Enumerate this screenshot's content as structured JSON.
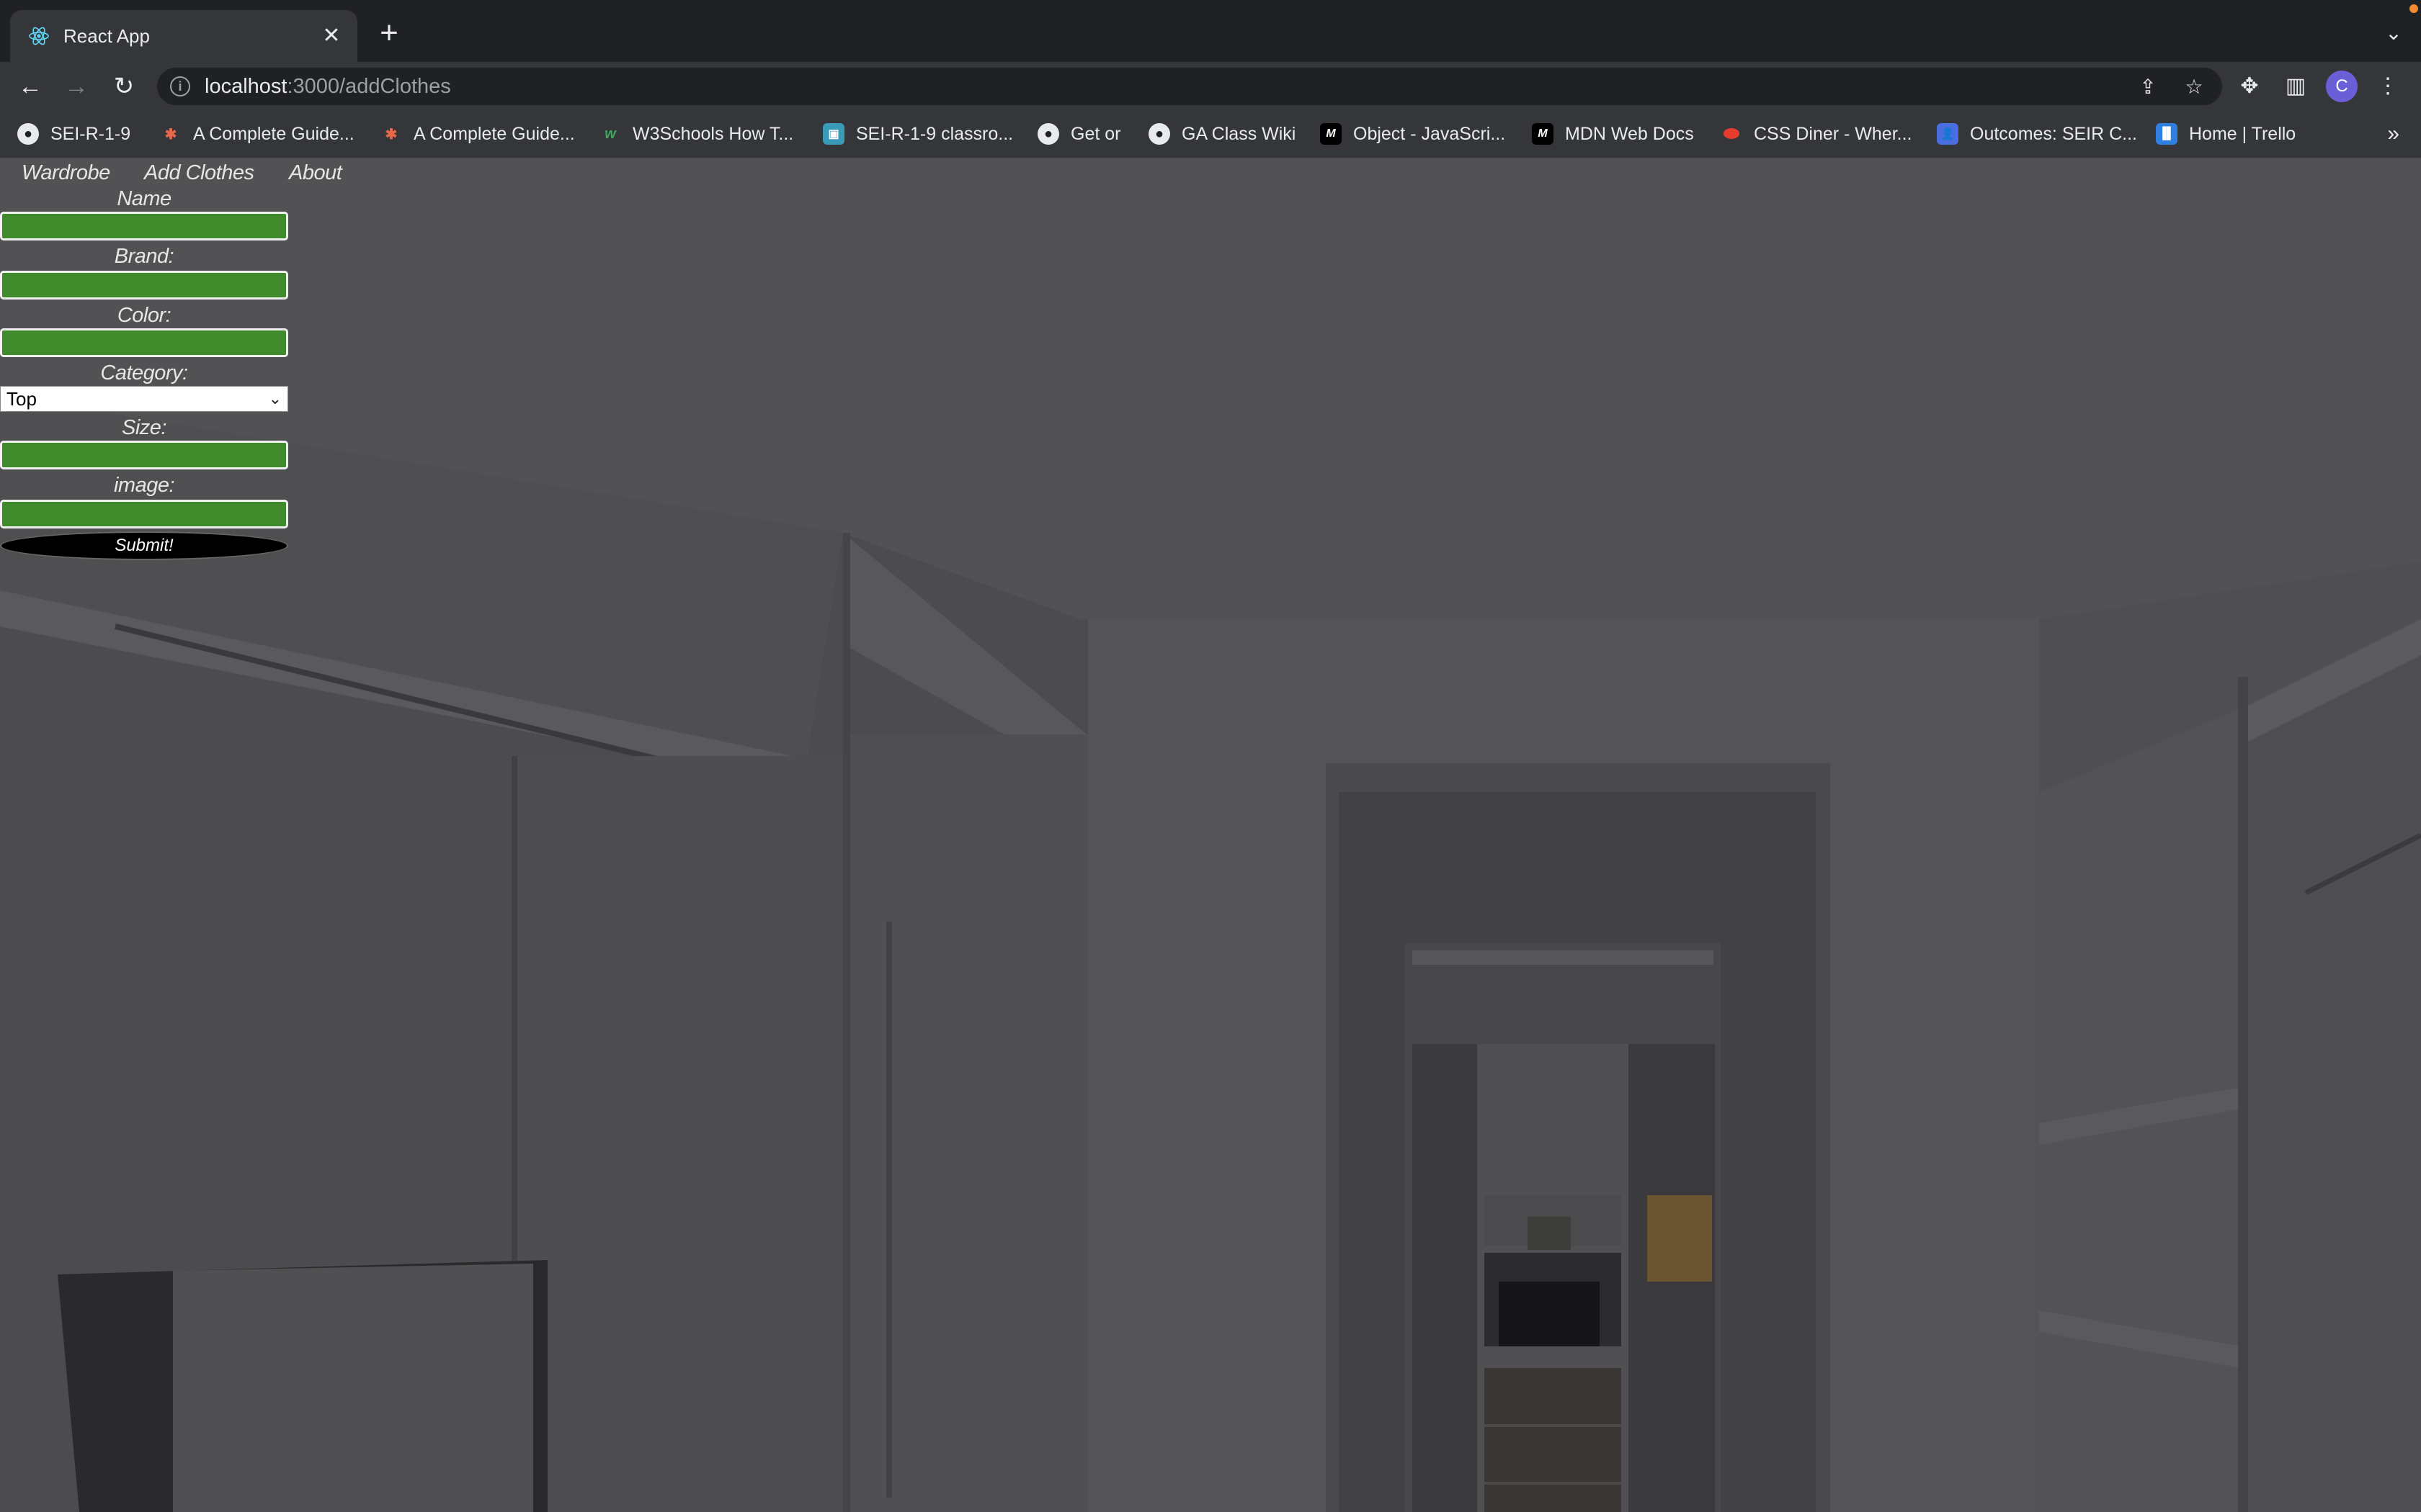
{
  "browser": {
    "tab": {
      "title": "React App"
    },
    "address": {
      "host": "localhost",
      "path": ":3000/addClothes"
    },
    "profile_initial": "C",
    "bookmarks": [
      {
        "label": "SEI-R-1-9",
        "icon": "github-icon"
      },
      {
        "label": "A Complete Guide...",
        "icon": "asterisk-icon"
      },
      {
        "label": "A Complete Guide...",
        "icon": "asterisk-icon"
      },
      {
        "label": "W3Schools How T...",
        "icon": "w3schools-icon"
      },
      {
        "label": "SEI-R-1-9 classro...",
        "icon": "classroom-icon"
      },
      {
        "label": "Get or",
        "icon": "github-icon"
      },
      {
        "label": "GA Class Wiki",
        "icon": "github-icon"
      },
      {
        "label": "Object - JavaScri...",
        "icon": "mdn-icon"
      },
      {
        "label": "MDN Web Docs",
        "icon": "mdn-icon"
      },
      {
        "label": "CSS Diner - Wher...",
        "icon": "css-diner-icon"
      },
      {
        "label": "Outcomes: SEIR C...",
        "icon": "person-icon"
      },
      {
        "label": "Home | Trello",
        "icon": "trello-icon"
      }
    ]
  },
  "nav": {
    "wardrobe": "Wardrobe",
    "add_clothes": "Add Clothes",
    "about": "About"
  },
  "form": {
    "name_label": "Name",
    "brand_label": "Brand:",
    "color_label": "Color:",
    "category_label": "Category:",
    "category_selected": "Top",
    "size_label": "Size:",
    "image_label": "image:",
    "submit_label": "Submit!",
    "input_color": "#3f8a2a"
  }
}
